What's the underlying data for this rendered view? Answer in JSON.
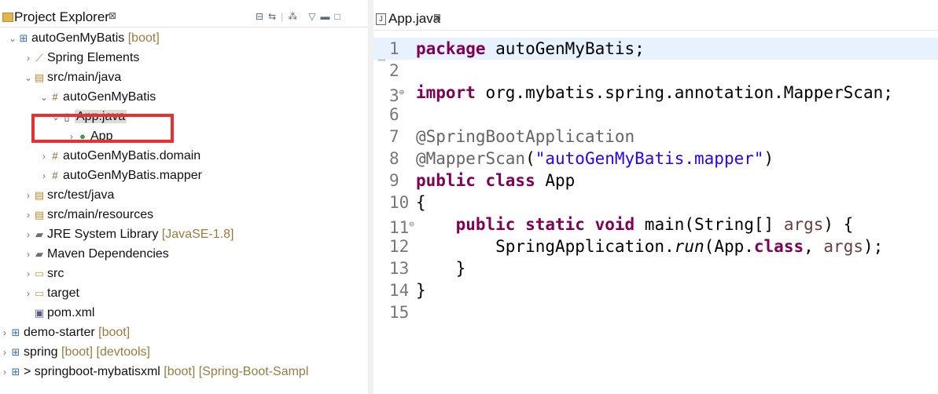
{
  "project_explorer": {
    "title": "Project Explorer",
    "close_glyph": "⊠",
    "toolbar_icons": [
      "collapse-all-icon",
      "link-with-editor-icon",
      "focus-icon",
      "view-menu-icon",
      "minimize-icon",
      "maximize-icon"
    ],
    "rows": [
      {
        "twisty": "⌄",
        "icon": "⊞",
        "label": "autoGenMyBatis",
        "decoration": "[boot]"
      },
      {
        "twisty": "›",
        "icon": "⟋",
        "label": "Spring Elements",
        "decoration": ""
      },
      {
        "twisty": "⌄",
        "icon": "▤",
        "label": "src/main/java",
        "decoration": ""
      },
      {
        "twisty": "⌄",
        "icon": "#",
        "label": "autoGenMyBatis",
        "decoration": ""
      },
      {
        "twisty": "⌄",
        "icon": "▯",
        "label": "App.java",
        "decoration": ""
      },
      {
        "twisty": "›",
        "icon": "●",
        "label": "App",
        "decoration": ""
      },
      {
        "twisty": "›",
        "icon": "#",
        "label": "autoGenMyBatis.domain",
        "decoration": ""
      },
      {
        "twisty": "›",
        "icon": "#",
        "label": "autoGenMyBatis.mapper",
        "decoration": ""
      },
      {
        "twisty": "›",
        "icon": "▤",
        "label": "src/test/java",
        "decoration": ""
      },
      {
        "twisty": "›",
        "icon": "▤",
        "label": "src/main/resources",
        "decoration": ""
      },
      {
        "twisty": "›",
        "icon": "▰",
        "label": "JRE System Library",
        "decoration": "[JavaSE-1.8]"
      },
      {
        "twisty": "›",
        "icon": "▰",
        "label": "Maven Dependencies",
        "decoration": ""
      },
      {
        "twisty": "›",
        "icon": "▭",
        "label": "src",
        "decoration": ""
      },
      {
        "twisty": "›",
        "icon": "▭",
        "label": "target",
        "decoration": ""
      },
      {
        "twisty": "",
        "icon": "▣",
        "label": "pom.xml",
        "decoration": ""
      },
      {
        "twisty": "›",
        "icon": "⊞",
        "label": "demo-starter",
        "decoration": "[boot]"
      },
      {
        "twisty": "›",
        "icon": "⊞",
        "label": "spring",
        "decoration": "[boot] [devtools]"
      },
      {
        "twisty": "›",
        "icon": "⊞",
        "label": "> springboot-mybatisxml",
        "decoration": "[boot] [Spring-Boot-Sampl"
      }
    ]
  },
  "editor": {
    "tab_label": "App.java",
    "tab_close": "⊠",
    "lines": [
      {
        "n": "1",
        "fold": "",
        "segments": [
          {
            "t": "package",
            "c": "kw"
          },
          {
            "t": " autoGenMyBatis;",
            "c": ""
          }
        ]
      },
      {
        "n": "2",
        "fold": "",
        "segments": []
      },
      {
        "n": "3",
        "fold": "⊕",
        "segments": [
          {
            "t": "import",
            "c": "kw"
          },
          {
            "t": " org.mybatis.spring.annotation.MapperScan;",
            "c": ""
          }
        ]
      },
      {
        "n": "6",
        "fold": "",
        "segments": []
      },
      {
        "n": "7",
        "fold": "",
        "segments": [
          {
            "t": "@SpringBootApplication",
            "c": "ann"
          }
        ]
      },
      {
        "n": "8",
        "fold": "",
        "segments": [
          {
            "t": "@MapperScan",
            "c": "ann"
          },
          {
            "t": "(",
            "c": ""
          },
          {
            "t": "\"autoGenMyBatis.mapper\"",
            "c": "str"
          },
          {
            "t": ")",
            "c": ""
          }
        ]
      },
      {
        "n": "9",
        "fold": "",
        "segments": [
          {
            "t": "public class",
            "c": "kw"
          },
          {
            "t": " App",
            "c": ""
          }
        ]
      },
      {
        "n": "10",
        "fold": "",
        "segments": [
          {
            "t": "{",
            "c": ""
          }
        ]
      },
      {
        "n": "11",
        "fold": "⊖",
        "segments": [
          {
            "t": "    ",
            "c": ""
          },
          {
            "t": "public static void",
            "c": "kw"
          },
          {
            "t": " main(String[] ",
            "c": ""
          },
          {
            "t": "args",
            "c": "param"
          },
          {
            "t": ") {",
            "c": ""
          }
        ]
      },
      {
        "n": "12",
        "fold": "",
        "segments": [
          {
            "t": "        SpringApplication.",
            "c": ""
          },
          {
            "t": "run",
            "c": "it"
          },
          {
            "t": "(App.",
            "c": ""
          },
          {
            "t": "class",
            "c": "kw"
          },
          {
            "t": ", ",
            "c": ""
          },
          {
            "t": "args",
            "c": "param"
          },
          {
            "t": ");",
            "c": ""
          }
        ]
      },
      {
        "n": "13",
        "fold": "",
        "segments": [
          {
            "t": "    }",
            "c": ""
          }
        ]
      },
      {
        "n": "14",
        "fold": "",
        "segments": [
          {
            "t": "}",
            "c": ""
          }
        ]
      },
      {
        "n": "15",
        "fold": "",
        "segments": []
      }
    ]
  },
  "colors": {
    "keyword": "#7f0055",
    "string": "#2a00ff",
    "annotation": "#646464",
    "highlight_box": "#e8312e",
    "current_line": "#e8f2fe"
  }
}
